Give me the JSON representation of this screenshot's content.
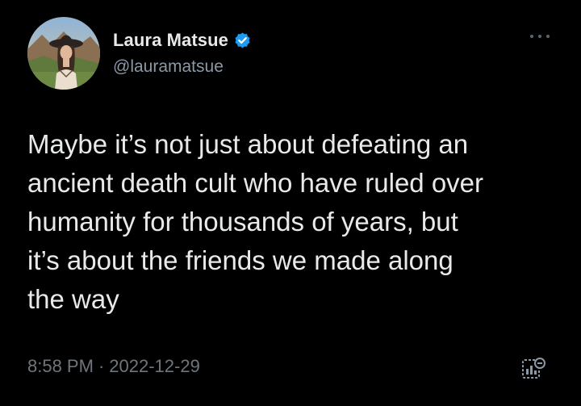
{
  "author": {
    "display_name": "Laura Matsue",
    "handle": "@lauramatsue",
    "verified": true,
    "avatar_icon": "profile-photo-woman-with-hat"
  },
  "tweet": {
    "text": "Maybe it’s not just about defeating an\nancient death cult who have ruled over\nhumanity for thousands of years, but\nit’s about the friends we made along\nthe way",
    "time": "8:58 PM",
    "separator": "·",
    "date": "2022-12-29"
  },
  "icons": {
    "more": "more-options-icon",
    "verified": "verified-badge-icon",
    "analytics": "tweet-analytics-icon"
  },
  "colors": {
    "background": "#000000",
    "text_primary": "#e7e9ea",
    "text_secondary": "#8b98a5",
    "verified_blue": "#1d9bf0"
  }
}
